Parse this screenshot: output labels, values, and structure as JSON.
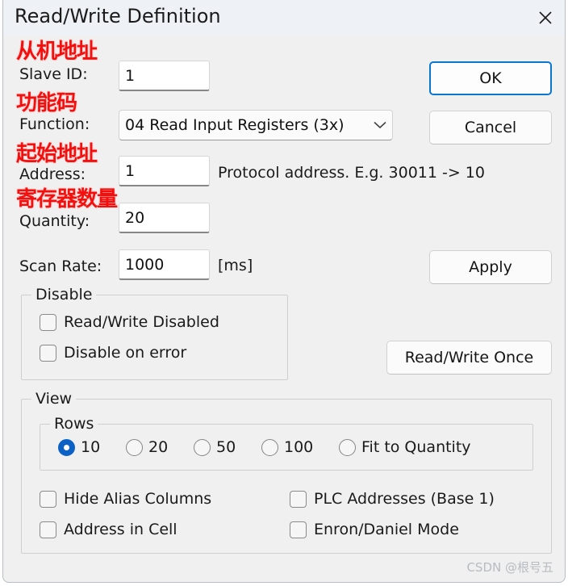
{
  "window": {
    "title": "Read/Write Definition",
    "close_icon": "close-icon"
  },
  "fields": {
    "slave_id": {
      "label": "Slave ID:",
      "value": "1",
      "annotation": "从机地址"
    },
    "function": {
      "label": "Function:",
      "value": "04 Read Input Registers (3x)",
      "annotation": "功能码",
      "arrow_icon": "chevron-down-icon"
    },
    "address": {
      "label": "Address:",
      "value": "1",
      "annotation": "起始地址",
      "hint": "Protocol address. E.g. 30011 -> 10"
    },
    "quantity": {
      "label": "Quantity:",
      "value": "20",
      "annotation": "寄存器数量"
    },
    "scan_rate": {
      "label": "Scan Rate:",
      "value": "1000",
      "unit": "[ms]"
    }
  },
  "buttons": {
    "ok": "OK",
    "cancel": "Cancel",
    "apply": "Apply",
    "read_write_once": "Read/Write Once"
  },
  "disable_group": {
    "title": "Disable",
    "items": [
      {
        "label": "Read/Write Disabled",
        "checked": false
      },
      {
        "label": "Disable on error",
        "checked": false
      }
    ]
  },
  "view_group": {
    "title": "View",
    "rows": {
      "title": "Rows",
      "options": [
        {
          "label": "10",
          "selected": true
        },
        {
          "label": "20",
          "selected": false
        },
        {
          "label": "50",
          "selected": false
        },
        {
          "label": "100",
          "selected": false
        },
        {
          "label": "Fit to Quantity",
          "selected": false
        }
      ]
    },
    "checkboxes": [
      {
        "label": "Hide Alias Columns",
        "checked": false
      },
      {
        "label": "PLC Addresses (Base 1)",
        "checked": false
      },
      {
        "label": "Address in Cell",
        "checked": false
      },
      {
        "label": "Enron/Daniel Mode",
        "checked": false
      }
    ]
  },
  "watermark": "CSDN @根号五",
  "colors": {
    "accent": "#0a76d0",
    "annotation_red": "#f2100f",
    "dialog_bg": "#f0f0f0",
    "titlebar_bg": "#eef2f6"
  }
}
